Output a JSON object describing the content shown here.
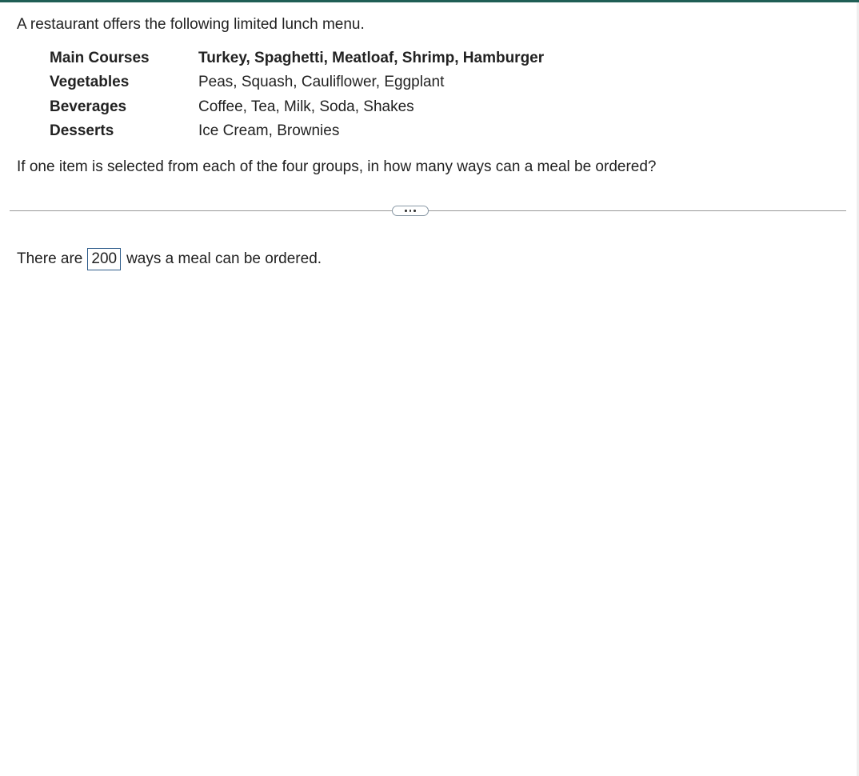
{
  "question": {
    "intro": "A restaurant offers the following limited lunch menu.",
    "prompt": "If one item is selected from each of the four groups, in how many ways can a meal be ordered?"
  },
  "menu": [
    {
      "category": "Main Courses",
      "items": "Turkey, Spaghetti, Meatloaf, Shrimp, Hamburger"
    },
    {
      "category": "Vegetables",
      "items": "Peas, Squash, Cauliflower, Eggplant"
    },
    {
      "category": "Beverages",
      "items": "Coffee, Tea, Milk, Soda, Shakes"
    },
    {
      "category": "Desserts",
      "items": "Ice Cream, Brownies"
    }
  ],
  "answer": {
    "prefix": "There are",
    "value": "200",
    "suffix": "ways a meal can be ordered."
  },
  "colors": {
    "top_accent": "#1f5e55",
    "answer_border": "#2e5c8a"
  }
}
